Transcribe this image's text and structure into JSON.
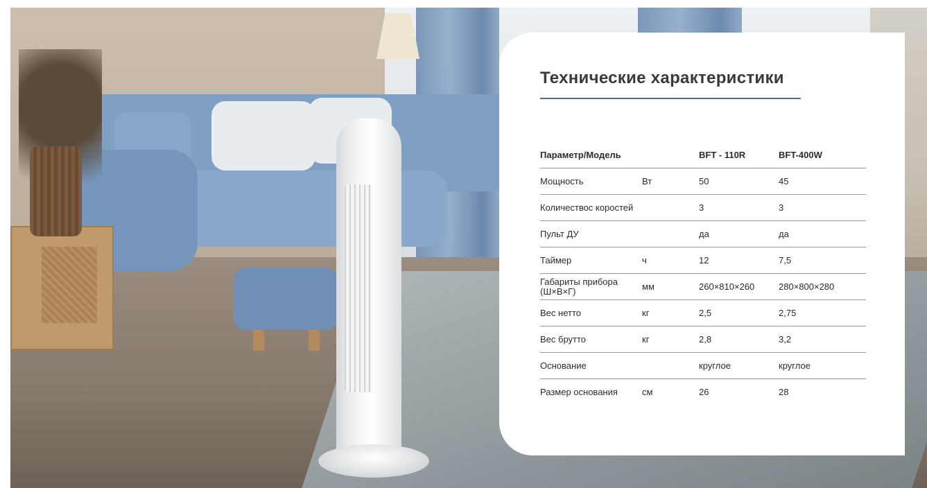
{
  "title": "Технические характеристики",
  "table": {
    "headers": [
      "Параметр/Модель",
      "",
      "BFT - 110R",
      "BFT-400W"
    ],
    "rows": [
      {
        "param": "Мощность",
        "unit": "Вт",
        "a": "50",
        "b": "45"
      },
      {
        "param": "Количествос коростей",
        "unit": "",
        "a": "3",
        "b": "3"
      },
      {
        "param": "Пульт ДУ",
        "unit": "",
        "a": "да",
        "b": "да"
      },
      {
        "param": "Таймер",
        "unit": "ч",
        "a": "12",
        "b": "7,5"
      },
      {
        "param": "Габариты прибора (Ш×В×Г)",
        "unit": "мм",
        "a": "260×810×260",
        "b": "280×800×280"
      },
      {
        "param": "Вес нетто",
        "unit": "кг",
        "a": "2,5",
        "b": "2,75"
      },
      {
        "param": "Вес брутто",
        "unit": "кг",
        "a": "2,8",
        "b": "3,2"
      },
      {
        "param": "Основание",
        "unit": "",
        "a": "круглое",
        "b": "круглое"
      },
      {
        "param": "Размер основания",
        "unit": "см",
        "a": "26",
        "b": "28"
      }
    ]
  },
  "colors": {
    "rule": "#4f6f8f",
    "text": "#2b2b2b",
    "card": "#ffffff"
  }
}
